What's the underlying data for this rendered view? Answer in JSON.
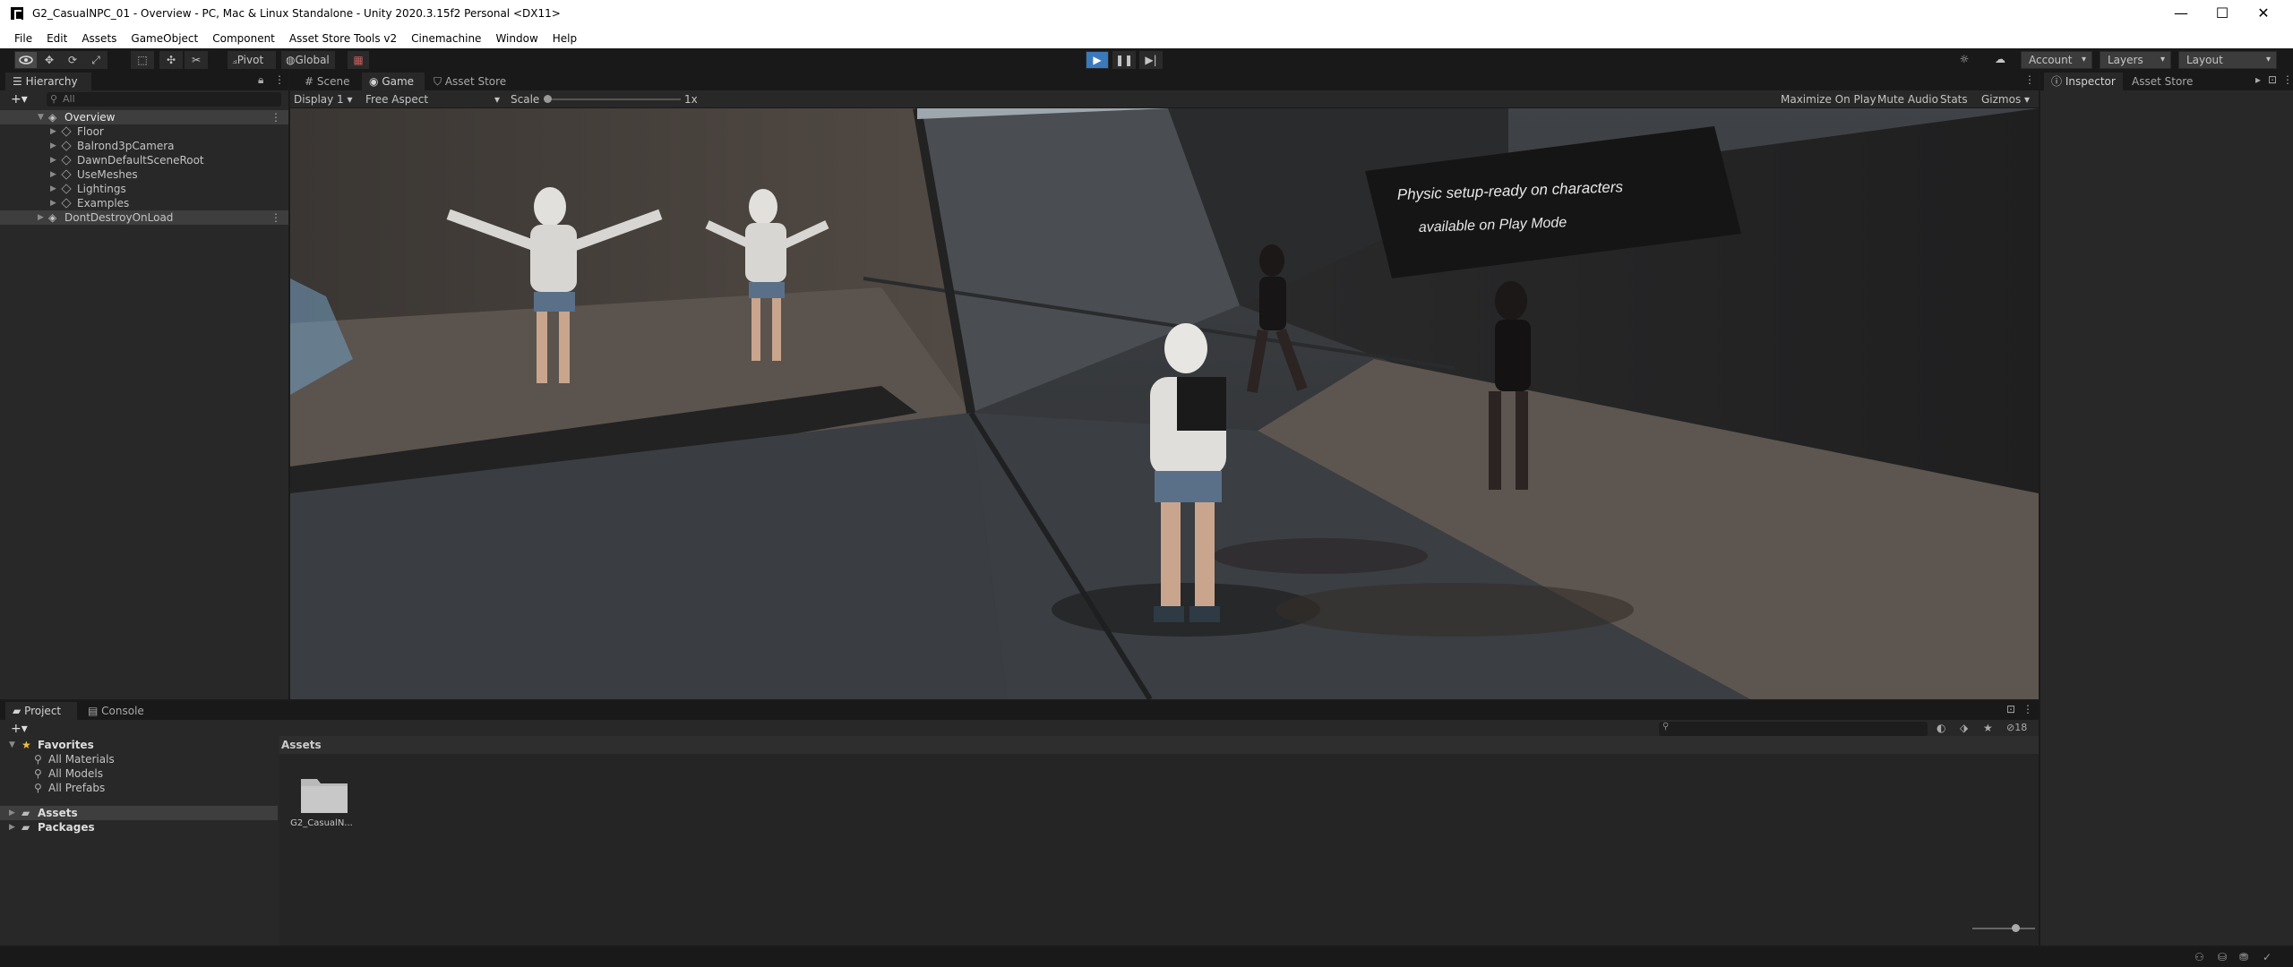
{
  "window": {
    "title": "G2_CasualNPC_01 - Overview - PC, Mac & Linux Standalone - Unity 2020.3.15f2 Personal <DX11>",
    "controls": [
      "—",
      "☐",
      "✕"
    ]
  },
  "menu": [
    "File",
    "Edit",
    "Assets",
    "GameObject",
    "Component",
    "Asset Store Tools v2",
    "Cinemachine",
    "Window",
    "Help"
  ],
  "toolbar": {
    "pivot_label": "Pivot",
    "global_label": "Global",
    "account_label": "Account",
    "layers_label": "Layers",
    "layout_label": "Layout",
    "play_state": "playing"
  },
  "hierarchy": {
    "tab_label": "Hierarchy",
    "search_placeholder": "All",
    "items": [
      {
        "label": "Overview",
        "type": "scene",
        "expanded": true
      },
      {
        "label": "Floor",
        "type": "object"
      },
      {
        "label": "Balrond3pCamera",
        "type": "object"
      },
      {
        "label": "DawnDefaultSceneRoot",
        "type": "object"
      },
      {
        "label": "UseMeshes",
        "type": "object"
      },
      {
        "label": "Lightings",
        "type": "object"
      },
      {
        "label": "Examples",
        "type": "object"
      },
      {
        "label": "DontDestroyOnLoad",
        "type": "scene",
        "expanded": false
      }
    ]
  },
  "center_tabs": [
    "Scene",
    "Game",
    "Asset Store"
  ],
  "game_toolbar": {
    "display": "Display 1",
    "aspect": "Free Aspect",
    "scale_label": "Scale",
    "scale_value": "1x",
    "maximize": "Maximize On Play",
    "mute": "Mute Audio",
    "stats": "Stats",
    "gizmos": "Gizmos"
  },
  "game_view": {
    "sign_line1": "Physic setup-ready on characters",
    "sign_line2": "available on Play Mode"
  },
  "right_tabs": [
    "Inspector",
    "Asset Store Uploader"
  ],
  "project": {
    "tabs": [
      "Project",
      "Console"
    ],
    "hidden_count": "18",
    "favorites_label": "Favorites",
    "favorites": [
      "All Materials",
      "All Models",
      "All Prefabs"
    ],
    "roots": [
      "Assets",
      "Packages"
    ],
    "breadcrumb": "Assets",
    "assets": [
      {
        "name": "G2_CasualN..."
      }
    ]
  },
  "colors": {
    "play_blue": "#3a79bb",
    "selection_blue": "#2c5d87",
    "panel_bg": "#282828",
    "tab_bg": "#191919"
  }
}
